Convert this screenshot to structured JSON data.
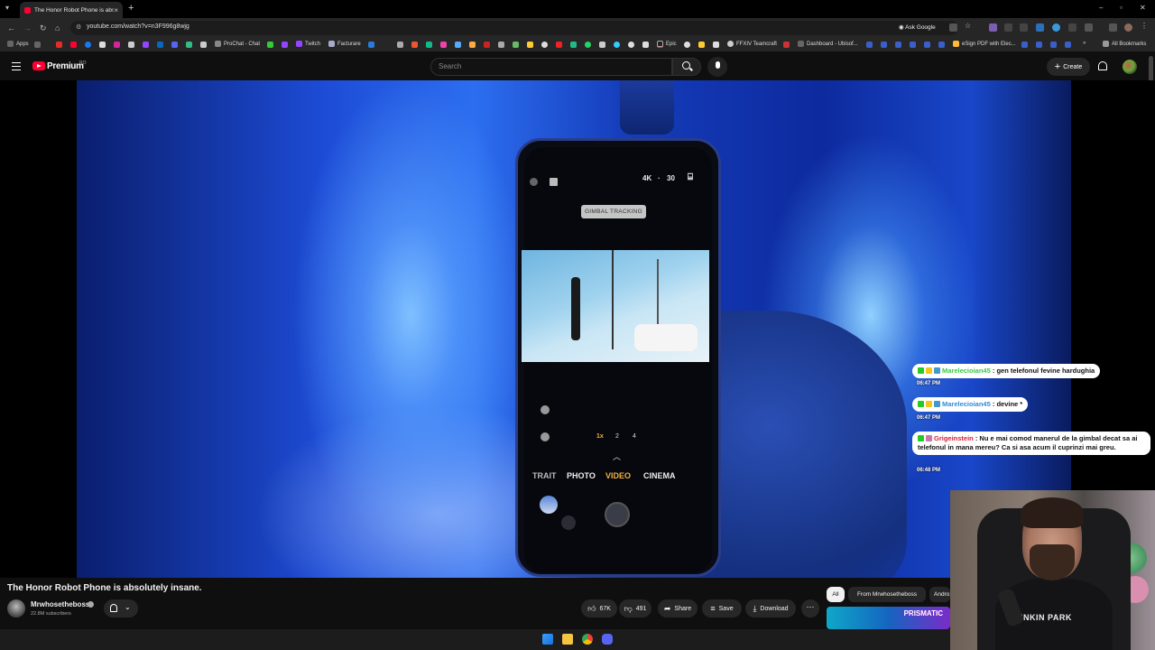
{
  "browser": {
    "tab_title": "The Honor Robot Phone is abs...",
    "url": "youtube.com/watch?v=n3F996g8wjg",
    "ask_google": "Ask Google",
    "all_bookmarks": "All Bookmarks"
  },
  "bookmarks": [
    {
      "label": "Apps"
    },
    {
      "label": "ProChat - Chat"
    },
    {
      "label": "Twitch"
    },
    {
      "label": "Facturare"
    },
    {
      "label": "Epic"
    },
    {
      "label": "FFXIV Teamcraft"
    },
    {
      "label": "Dashboard - Ubisof..."
    },
    {
      "label": "eSign PDF with Elec..."
    }
  ],
  "youtube": {
    "premium_label": "Premium",
    "region": "RO",
    "search_placeholder": "Search",
    "create_label": "Create"
  },
  "video": {
    "title": "The Honor Robot Phone is absolutely insane.",
    "channel": "Mrwhosetheboss",
    "subscribers": "22.8M subscribers",
    "likes": "67K",
    "dislikes": "491",
    "share_label": "Share",
    "save_label": "Save",
    "download_label": "Download"
  },
  "phone_ui": {
    "resolution": "4K",
    "fps": "30",
    "tag": "GIMBAL TRACKING",
    "zoom_levels": [
      "1x",
      "2",
      "4"
    ],
    "modes": [
      "TRAIT",
      "PHOTO",
      "VIDEO",
      "CINEMA"
    ]
  },
  "chips": {
    "all": "All",
    "from_channel": "From Mrwhosetheboss",
    "related": "Andro"
  },
  "chat": [
    {
      "user": "Marelecioian45",
      "text": " : gen telefonul fevine hardughia",
      "time": "06:47 PM"
    },
    {
      "user": "Marelecioian45",
      "text": " : devine *",
      "time": "06:47 PM"
    },
    {
      "user": "Grigeinstein",
      "text": " : Nu e mai comod manerul de la gimbal decat sa ai telefonul in mana mereu? Ca si asa acum il cuprinzi mai greu.",
      "time": "06:48 PM"
    }
  ],
  "webcam": {
    "shirt_text": "LINKIN PARK"
  },
  "thumbnail": {
    "text": "PRISMATIC"
  },
  "colors": {
    "youtube_red": "#ff0033",
    "background": "#0f0f0f",
    "pill_bg": "#272727",
    "chat_green": "#37c94a",
    "chat_red": "#d3243a"
  }
}
